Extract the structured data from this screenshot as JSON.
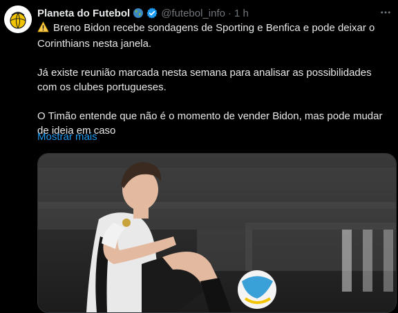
{
  "account": {
    "name": "Planeta do Futebol",
    "handle": "@futebol_info",
    "separator": "·",
    "time": "1 h"
  },
  "post": {
    "paragraphs": [
      "Breno Bidon recebe sondagens de Sporting e Benfica e pode deixar o Corinthians nesta janela.",
      "Já existe reunião marcada nesta semana para analisar as possibilidades com os clubes portugueses.",
      "O Timão entende que não é o momento de vender Bidon, mas pode mudar de ideia em caso"
    ],
    "show_more": "Mostrar mais"
  },
  "icons": {
    "avatar": "planeta-do-futebol-logo",
    "globe": "globe-icon",
    "verified": "verified-badge-icon",
    "more": "more-options-icon",
    "warning": "warning-emoji-icon"
  },
  "colors": {
    "background": "#000000",
    "text": "#e7e9ea",
    "secondary": "#71767b",
    "link": "#1d9bf0",
    "verified": "#1d9bf0",
    "warning": "#ffcc4d"
  }
}
